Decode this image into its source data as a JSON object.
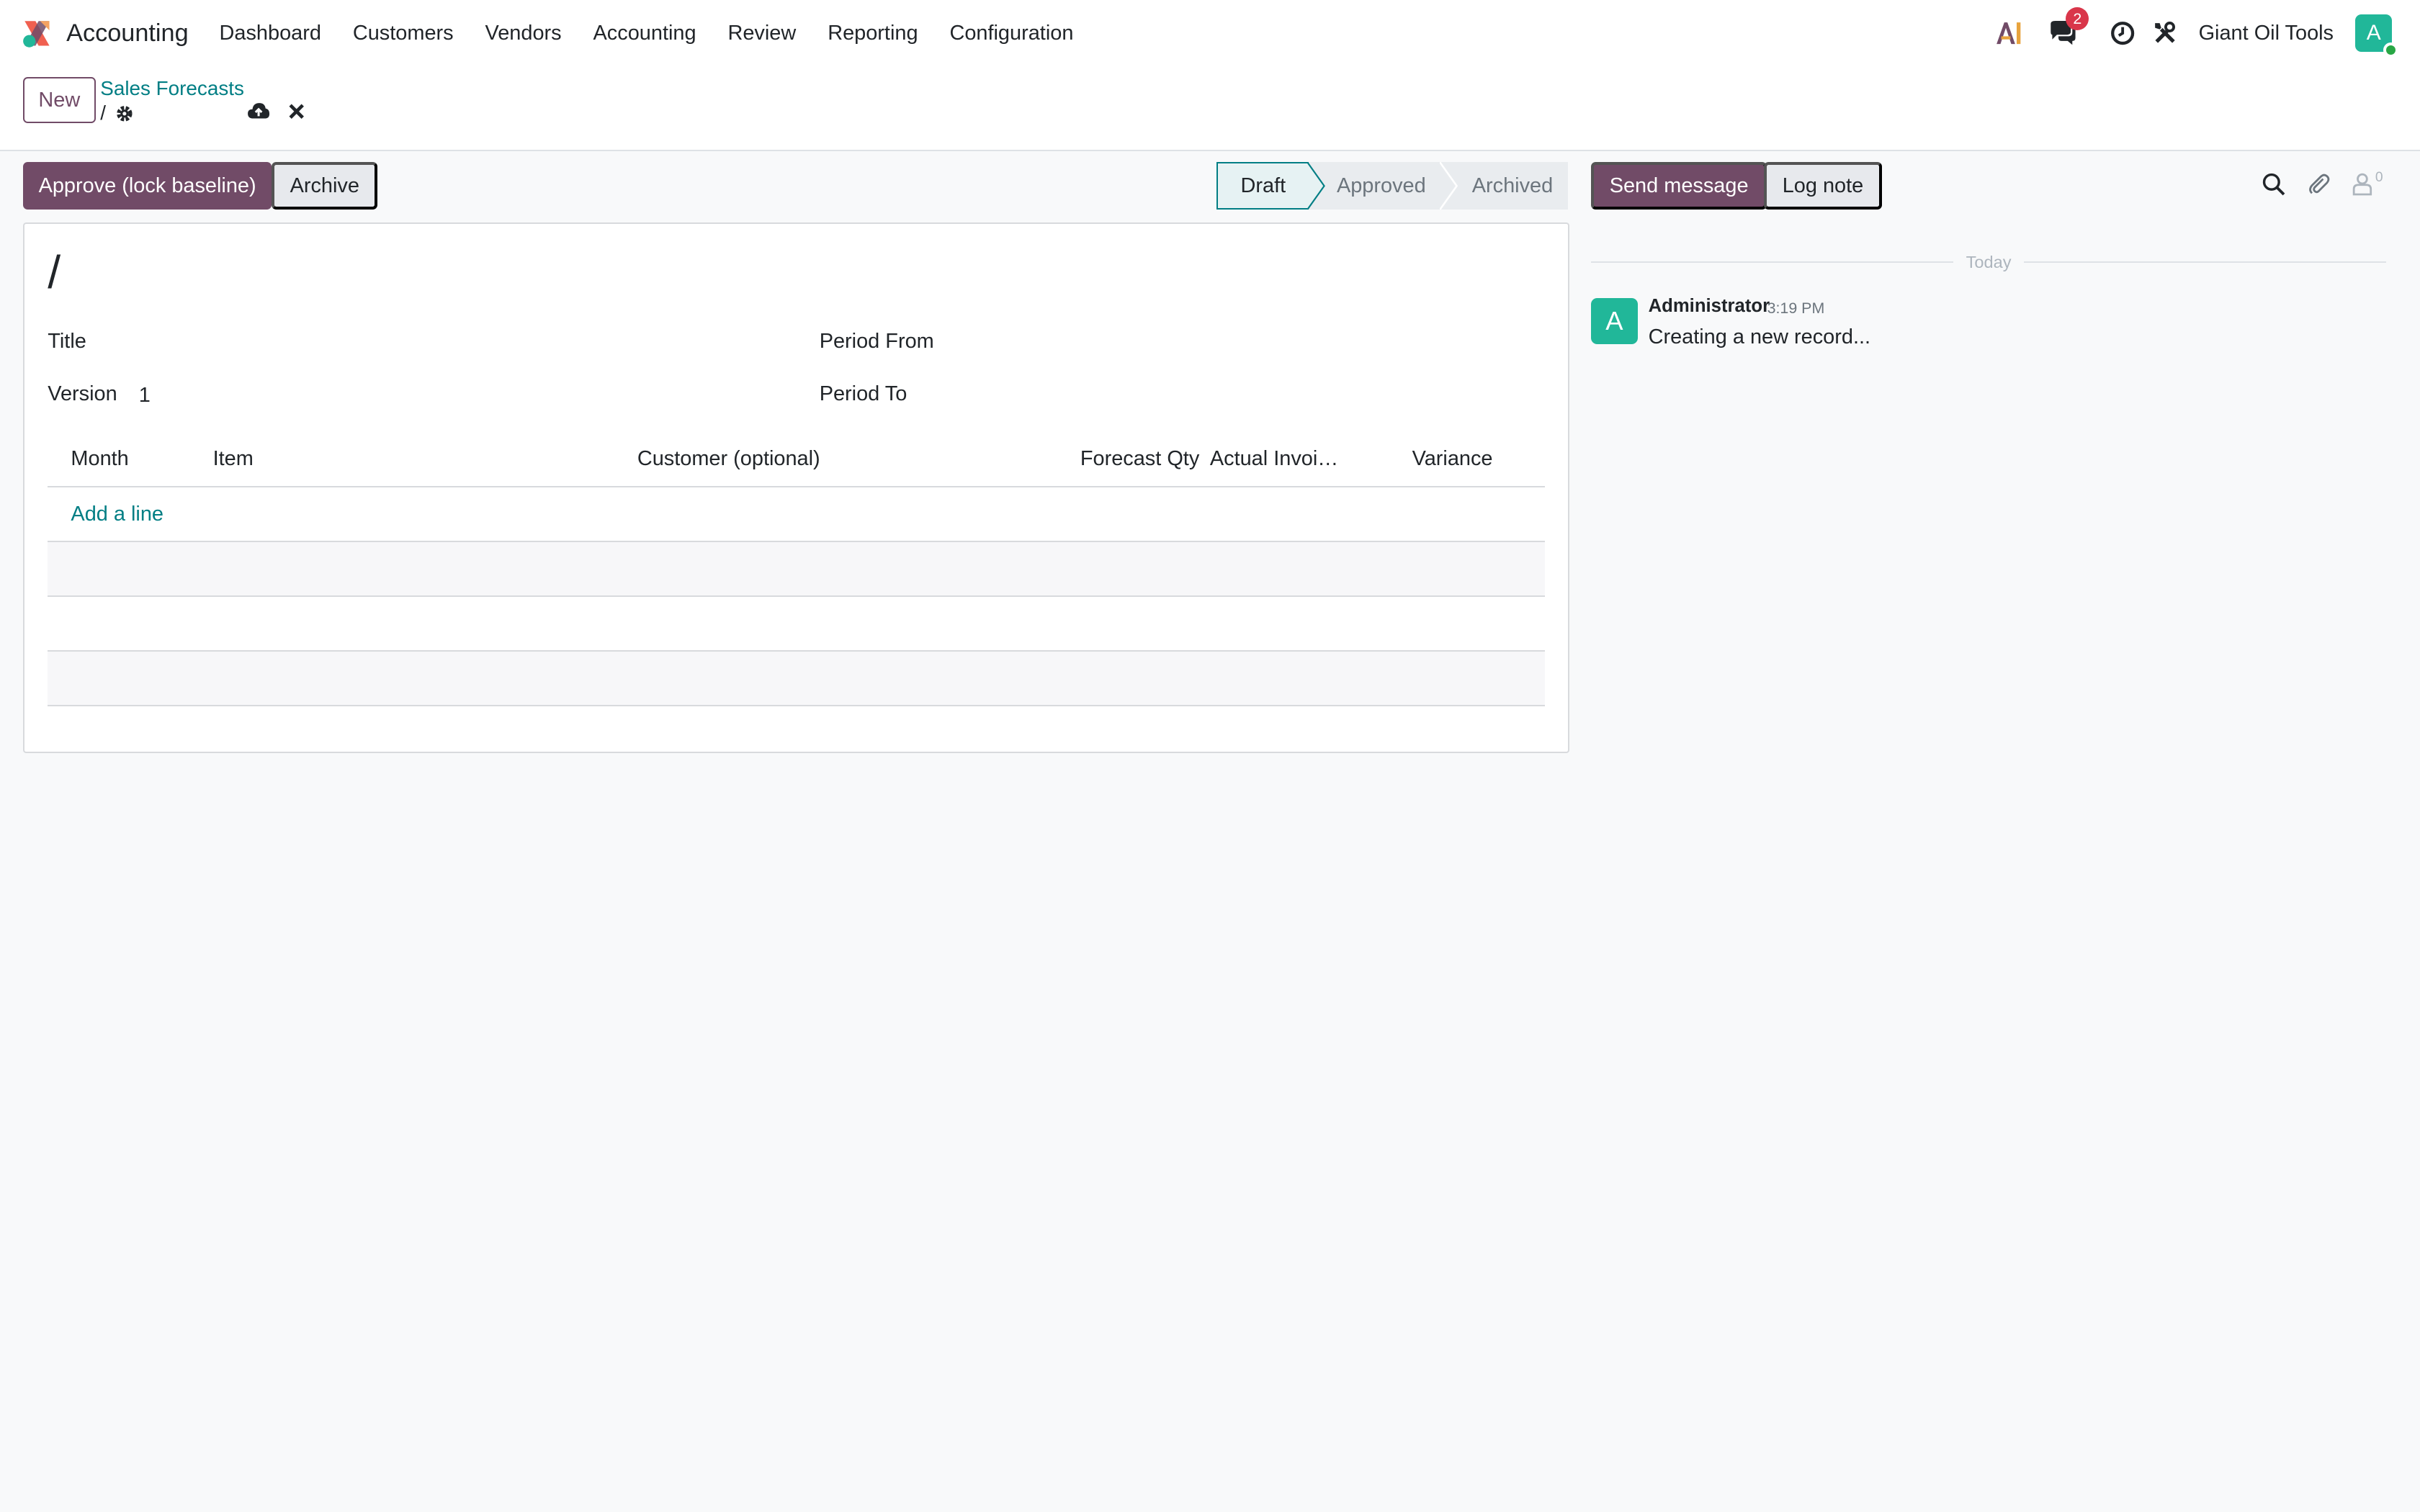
{
  "navbar": {
    "app_title": "Accounting",
    "menu": [
      "Dashboard",
      "Customers",
      "Vendors",
      "Accounting",
      "Review",
      "Reporting",
      "Configuration"
    ],
    "messages_badge": "2",
    "company": "Giant Oil Tools",
    "user_initial": "A",
    "icons": [
      "odoo-app-icon",
      "ai-icon",
      "chat-icon",
      "clock-icon",
      "tools-icon"
    ]
  },
  "control_panel": {
    "new_label": "New",
    "breadcrumb_parent": "Sales Forecasts",
    "breadcrumb_current": "/"
  },
  "actions": {
    "approve_label": "Approve (lock baseline)",
    "archive_label": "Archive"
  },
  "statusbar": {
    "stages": [
      "Draft",
      "Approved",
      "Archived"
    ],
    "active": "Draft"
  },
  "form": {
    "record_name": "/",
    "title_label": "Title",
    "version_label": "Version",
    "version_value": "1",
    "period_from_label": "Period From",
    "period_to_label": "Period To",
    "table": {
      "columns": [
        "Month",
        "Item",
        "Customer (optional)",
        "Forecast Qty",
        "Actual Invoi…",
        "Variance"
      ],
      "add_line_label": "Add a line"
    }
  },
  "chatter": {
    "send_message_label": "Send message",
    "log_note_label": "Log note",
    "followers_count": "0",
    "date_separator": "Today",
    "message": {
      "author_initial": "A",
      "author": "Administrator",
      "time": "3:19 PM",
      "body": "Creating a new record..."
    }
  },
  "colors": {
    "primary": "#714b67",
    "link": "#017e84",
    "avatar": "#21b799",
    "badge": "#d9364a"
  }
}
